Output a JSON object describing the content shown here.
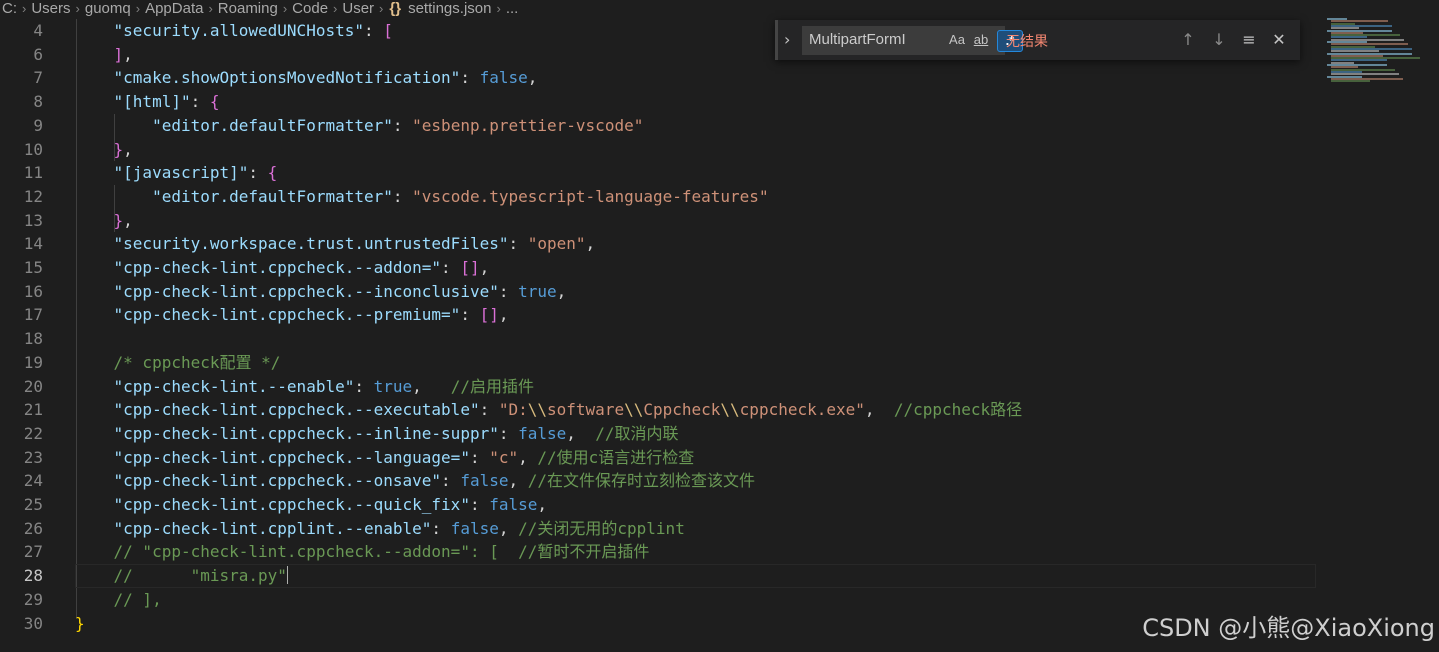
{
  "breadcrumb": {
    "items": [
      "C:",
      "Users",
      "guomq",
      "AppData",
      "Roaming",
      "Code",
      "User",
      "settings.json",
      "..."
    ],
    "file_icon": "{}"
  },
  "find_widget": {
    "query": "MultipartFormI",
    "match_case_label": "Aa",
    "whole_word_label": "ab",
    "regex_label": ".*",
    "result_text": "无结果",
    "regex_enabled": true
  },
  "editor": {
    "lines": [
      {
        "num": "4",
        "tokens": [
          [
            "p",
            "    "
          ],
          [
            "k",
            "\"security.allowedUNCHosts\""
          ],
          [
            "p",
            ": "
          ],
          [
            "p1",
            "["
          ]
        ]
      },
      {
        "num": "6",
        "tokens": [
          [
            "p",
            "    "
          ],
          [
            "p1",
            "]"
          ],
          [
            "p",
            ","
          ]
        ]
      },
      {
        "num": "7",
        "tokens": [
          [
            "p",
            "    "
          ],
          [
            "k",
            "\"cmake.showOptionsMovedNotification\""
          ],
          [
            "p",
            ": "
          ],
          [
            "b",
            "false"
          ],
          [
            "p",
            ","
          ]
        ]
      },
      {
        "num": "8",
        "tokens": [
          [
            "p",
            "    "
          ],
          [
            "k",
            "\"[html]\""
          ],
          [
            "p",
            ": "
          ],
          [
            "p1",
            "{"
          ]
        ]
      },
      {
        "num": "9",
        "tokens": [
          [
            "p",
            "        "
          ],
          [
            "k",
            "\"editor.defaultFormatter\""
          ],
          [
            "p",
            ": "
          ],
          [
            "s",
            "\"esbenp.prettier-vscode\""
          ]
        ]
      },
      {
        "num": "10",
        "tokens": [
          [
            "p",
            "    "
          ],
          [
            "p1",
            "}"
          ],
          [
            "p",
            ","
          ]
        ]
      },
      {
        "num": "11",
        "tokens": [
          [
            "p",
            "    "
          ],
          [
            "k",
            "\"[javascript]\""
          ],
          [
            "p",
            ": "
          ],
          [
            "p1",
            "{"
          ]
        ]
      },
      {
        "num": "12",
        "tokens": [
          [
            "p",
            "        "
          ],
          [
            "k",
            "\"editor.defaultFormatter\""
          ],
          [
            "p",
            ": "
          ],
          [
            "s",
            "\"vscode.typescript-language-features\""
          ]
        ]
      },
      {
        "num": "13",
        "tokens": [
          [
            "p",
            "    "
          ],
          [
            "p1",
            "}"
          ],
          [
            "p",
            ","
          ]
        ]
      },
      {
        "num": "14",
        "tokens": [
          [
            "p",
            "    "
          ],
          [
            "k",
            "\"security.workspace.trust.untrustedFiles\""
          ],
          [
            "p",
            ": "
          ],
          [
            "s",
            "\"open\""
          ],
          [
            "p",
            ","
          ]
        ]
      },
      {
        "num": "15",
        "tokens": [
          [
            "p",
            "    "
          ],
          [
            "k",
            "\"cpp-check-lint.cppcheck.--addon=\""
          ],
          [
            "p",
            ": "
          ],
          [
            "p1",
            "[]"
          ],
          [
            "p",
            ","
          ]
        ]
      },
      {
        "num": "16",
        "tokens": [
          [
            "p",
            "    "
          ],
          [
            "k",
            "\"cpp-check-lint.cppcheck.--inconclusive\""
          ],
          [
            "p",
            ": "
          ],
          [
            "b",
            "true"
          ],
          [
            "p",
            ","
          ]
        ]
      },
      {
        "num": "17",
        "tokens": [
          [
            "p",
            "    "
          ],
          [
            "k",
            "\"cpp-check-lint.cppcheck.--premium=\""
          ],
          [
            "p",
            ": "
          ],
          [
            "p1",
            "[]"
          ],
          [
            "p",
            ","
          ]
        ]
      },
      {
        "num": "18",
        "tokens": []
      },
      {
        "num": "19",
        "tokens": [
          [
            "p",
            "    "
          ],
          [
            "c",
            "/* cppcheck配置 */"
          ]
        ]
      },
      {
        "num": "20",
        "tokens": [
          [
            "p",
            "    "
          ],
          [
            "k",
            "\"cpp-check-lint.--enable\""
          ],
          [
            "p",
            ": "
          ],
          [
            "b",
            "true"
          ],
          [
            "p",
            ",   "
          ],
          [
            "c",
            "//启用插件"
          ]
        ]
      },
      {
        "num": "21",
        "tokens": [
          [
            "p",
            "    "
          ],
          [
            "k",
            "\"cpp-check-lint.cppcheck.--executable\""
          ],
          [
            "p",
            ": "
          ],
          [
            "s",
            "\"D:"
          ],
          [
            "esc",
            "\\\\"
          ],
          [
            "s",
            "software"
          ],
          [
            "esc",
            "\\\\"
          ],
          [
            "s",
            "Cppcheck"
          ],
          [
            "esc",
            "\\\\"
          ],
          [
            "s",
            "cppcheck.exe\""
          ],
          [
            "p",
            ",  "
          ],
          [
            "c",
            "//cppcheck路径"
          ]
        ]
      },
      {
        "num": "22",
        "tokens": [
          [
            "p",
            "    "
          ],
          [
            "k",
            "\"cpp-check-lint.cppcheck.--inline-suppr\""
          ],
          [
            "p",
            ": "
          ],
          [
            "b",
            "false"
          ],
          [
            "p",
            ",  "
          ],
          [
            "c",
            "//取消内联"
          ]
        ]
      },
      {
        "num": "23",
        "tokens": [
          [
            "p",
            "    "
          ],
          [
            "k",
            "\"cpp-check-lint.cppcheck.--language=\""
          ],
          [
            "p",
            ": "
          ],
          [
            "s",
            "\"c\""
          ],
          [
            "p",
            ", "
          ],
          [
            "c",
            "//使用c语言进行检查"
          ]
        ]
      },
      {
        "num": "24",
        "tokens": [
          [
            "p",
            "    "
          ],
          [
            "k",
            "\"cpp-check-lint.cppcheck.--onsave\""
          ],
          [
            "p",
            ": "
          ],
          [
            "b",
            "false"
          ],
          [
            "p",
            ", "
          ],
          [
            "c",
            "//在文件保存时立刻检查该文件"
          ]
        ]
      },
      {
        "num": "25",
        "tokens": [
          [
            "p",
            "    "
          ],
          [
            "k",
            "\"cpp-check-lint.cppcheck.--quick_fix\""
          ],
          [
            "p",
            ": "
          ],
          [
            "b",
            "false"
          ],
          [
            "p",
            ","
          ]
        ]
      },
      {
        "num": "26",
        "tokens": [
          [
            "p",
            "    "
          ],
          [
            "k",
            "\"cpp-check-lint.cpplint.--enable\""
          ],
          [
            "p",
            ": "
          ],
          [
            "b",
            "false"
          ],
          [
            "p",
            ", "
          ],
          [
            "c",
            "//关闭无用的cpplint"
          ]
        ]
      },
      {
        "num": "27",
        "tokens": [
          [
            "p",
            "    "
          ],
          [
            "c",
            "// \"cpp-check-lint.cppcheck.--addon=\": [  //暂时不开启插件"
          ]
        ]
      },
      {
        "num": "28",
        "tokens": [
          [
            "p",
            "    "
          ],
          [
            "c",
            "//      \"misra.py\""
          ]
        ],
        "active": true
      },
      {
        "num": "29",
        "tokens": [
          [
            "p",
            "    "
          ],
          [
            "c",
            "// ],"
          ]
        ]
      },
      {
        "num": "30",
        "tokens": [
          [
            "p2",
            "}"
          ]
        ]
      }
    ]
  },
  "watermark": "CSDN @小熊@XiaoXiong",
  "colors": {
    "background": "#1e1e1e",
    "string": "#ce9178",
    "keyword": "#569cd6",
    "comment": "#6a9955",
    "bracket_pink": "#da70d6",
    "bracket_gold": "#ffd700",
    "no_results": "#f48771"
  },
  "icons": [
    "json-file-icon",
    "chevron-right-icon",
    "arrow-up-icon",
    "arrow-down-icon",
    "selection-icon",
    "close-icon"
  ]
}
